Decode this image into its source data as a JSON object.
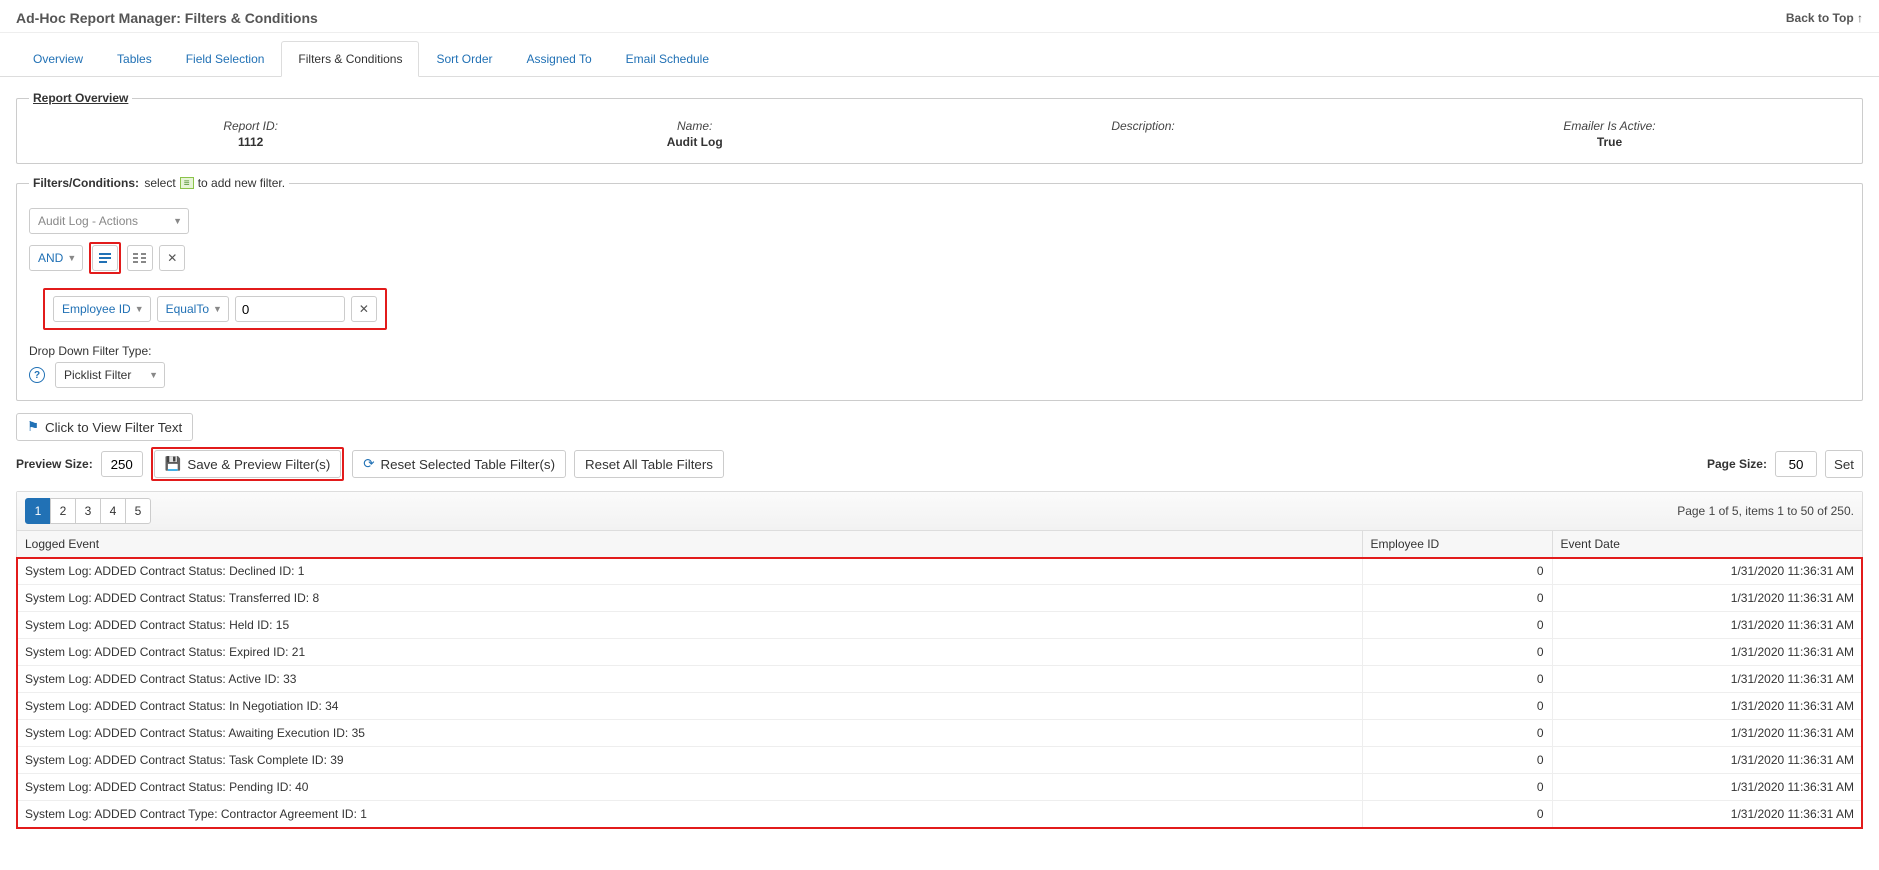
{
  "header": {
    "title": "Ad-Hoc Report Manager: Filters & Conditions",
    "back_to_top": "Back to Top ↑"
  },
  "tabs": [
    {
      "label": "Overview",
      "active": false
    },
    {
      "label": "Tables",
      "active": false
    },
    {
      "label": "Field Selection",
      "active": false
    },
    {
      "label": "Filters & Conditions",
      "active": true
    },
    {
      "label": "Sort Order",
      "active": false
    },
    {
      "label": "Assigned To",
      "active": false
    },
    {
      "label": "Email Schedule",
      "active": false
    }
  ],
  "overview": {
    "legend": "Report Overview",
    "items": [
      {
        "label": "Report ID:",
        "value": "1112"
      },
      {
        "label": "Name:",
        "value": "Audit Log"
      },
      {
        "label": "Description:",
        "value": ""
      },
      {
        "label": "Emailer Is Active:",
        "value": "True"
      }
    ]
  },
  "filters_section": {
    "legend_strong": "Filters/Conditions:",
    "legend_rest": " select ",
    "legend_tail": " to add new filter.",
    "table_select": "Audit Log - Actions",
    "conjunction": "AND",
    "condition": {
      "field": "Employee ID",
      "operator": "EqualTo",
      "value": "0"
    },
    "dd_filter_type_label": "Drop Down Filter Type:",
    "dd_filter_type_value": "Picklist Filter"
  },
  "buttons": {
    "view_filter_text": "Click to View Filter Text",
    "save_preview": "Save & Preview Filter(s)",
    "reset_selected": "Reset Selected Table Filter(s)",
    "reset_all": "Reset All Table Filters",
    "set": "Set"
  },
  "labels": {
    "preview_size": "Preview Size:",
    "page_size": "Page Size:"
  },
  "values": {
    "preview_size": "250",
    "page_size": "50"
  },
  "pager": {
    "pages": [
      "1",
      "2",
      "3",
      "4",
      "5"
    ],
    "active": "1",
    "info": "Page 1 of 5, items 1 to 50 of 250."
  },
  "table": {
    "headers": [
      "Logged Event",
      "Employee ID",
      "Event Date"
    ],
    "rows": [
      {
        "event": "System Log: ADDED Contract Status: Declined ID: 1",
        "emp": "0",
        "date": "1/31/2020 11:36:31 AM"
      },
      {
        "event": "System Log: ADDED Contract Status: Transferred ID: 8",
        "emp": "0",
        "date": "1/31/2020 11:36:31 AM"
      },
      {
        "event": "System Log: ADDED Contract Status: Held ID: 15",
        "emp": "0",
        "date": "1/31/2020 11:36:31 AM"
      },
      {
        "event": "System Log: ADDED Contract Status: Expired ID: 21",
        "emp": "0",
        "date": "1/31/2020 11:36:31 AM"
      },
      {
        "event": "System Log: ADDED Contract Status: Active ID: 33",
        "emp": "0",
        "date": "1/31/2020 11:36:31 AM"
      },
      {
        "event": "System Log: ADDED Contract Status: In Negotiation ID: 34",
        "emp": "0",
        "date": "1/31/2020 11:36:31 AM"
      },
      {
        "event": "System Log: ADDED Contract Status: Awaiting Execution ID: 35",
        "emp": "0",
        "date": "1/31/2020 11:36:31 AM"
      },
      {
        "event": "System Log: ADDED Contract Status: Task Complete ID: 39",
        "emp": "0",
        "date": "1/31/2020 11:36:31 AM"
      },
      {
        "event": "System Log: ADDED Contract Status: Pending ID: 40",
        "emp": "0",
        "date": "1/31/2020 11:36:31 AM"
      },
      {
        "event": "System Log: ADDED Contract Type: Contractor Agreement ID: 1",
        "emp": "0",
        "date": "1/31/2020 11:36:31 AM"
      }
    ]
  }
}
